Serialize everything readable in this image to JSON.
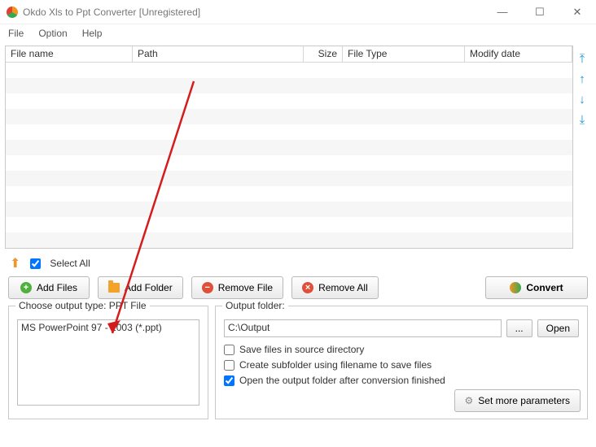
{
  "window": {
    "title": "Okdo Xls to Ppt Converter [Unregistered]"
  },
  "menu": {
    "file": "File",
    "option": "Option",
    "help": "Help"
  },
  "grid": {
    "cols": {
      "filename": "File name",
      "path": "Path",
      "size": "Size",
      "filetype": "File Type",
      "modify": "Modify date"
    }
  },
  "toolbar": {
    "select_all": "Select All",
    "add_files": "Add Files",
    "add_folder": "Add Folder",
    "remove_file": "Remove File",
    "remove_all": "Remove All",
    "convert": "Convert"
  },
  "output_type": {
    "label": "Choose output type:   PPT File",
    "item": "MS PowerPoint 97 - 2003 (*.ppt)"
  },
  "output_folder": {
    "label": "Output folder:",
    "value": "C:\\Output",
    "browse": "...",
    "open": "Open",
    "save_source": "Save files in source directory",
    "create_subfolder": "Create subfolder using filename to save files",
    "open_after": "Open the output folder after conversion finished",
    "more_params": "Set more parameters"
  }
}
